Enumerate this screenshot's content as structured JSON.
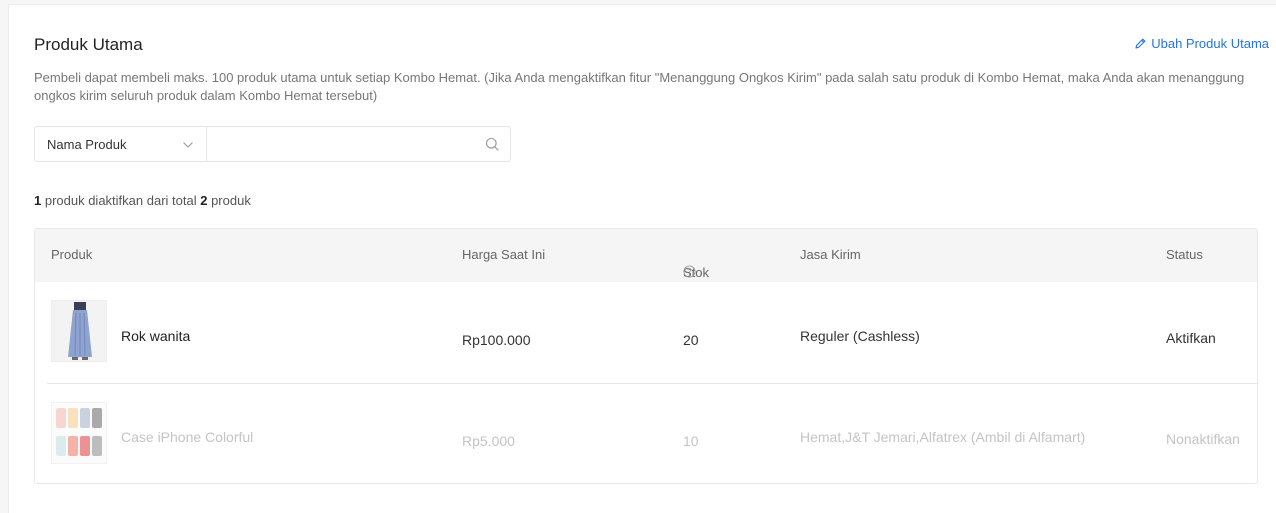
{
  "section": {
    "title": "Produk Utama",
    "edit_label": "Ubah Produk Utama",
    "description": "Pembeli dapat membeli maks. 100 produk utama untuk setiap Kombo Hemat. (Jika Anda mengaktifkan fitur \"Menanggung Ongkos Kirim\" pada salah satu produk di Kombo Hemat, maka Anda akan menanggung ongkos kirim seluruh produk dalam Kombo Hemat tersebut)"
  },
  "search": {
    "filter_selected": "Nama Produk",
    "query": "",
    "placeholder": ""
  },
  "summary": {
    "active": "1",
    "mid_text": " produk diaktifkan dari total ",
    "total": "2",
    "tail_text": " produk"
  },
  "table": {
    "headers": {
      "product": "Produk",
      "price": "Harga Saat Ini",
      "stock": "Stok",
      "shipping": "Jasa Kirim",
      "status": "Status"
    },
    "rows": [
      {
        "name": "Rok wanita",
        "price": "Rp100.000",
        "stock": "20",
        "shipping": "Reguler (Cashless)",
        "status": "Aktifkan",
        "active": true
      },
      {
        "name": "Case iPhone Colorful",
        "price": "Rp5.000",
        "stock": "10",
        "shipping": "Hemat,J&T Jemari,Alfatrex (Ambil di Alfamart)",
        "status": "Nonaktifkan",
        "active": false
      }
    ]
  },
  "colors": {
    "accent": "#2673dd",
    "text": "#333333",
    "muted": "#777777",
    "inactive": "#c4c4c4"
  }
}
